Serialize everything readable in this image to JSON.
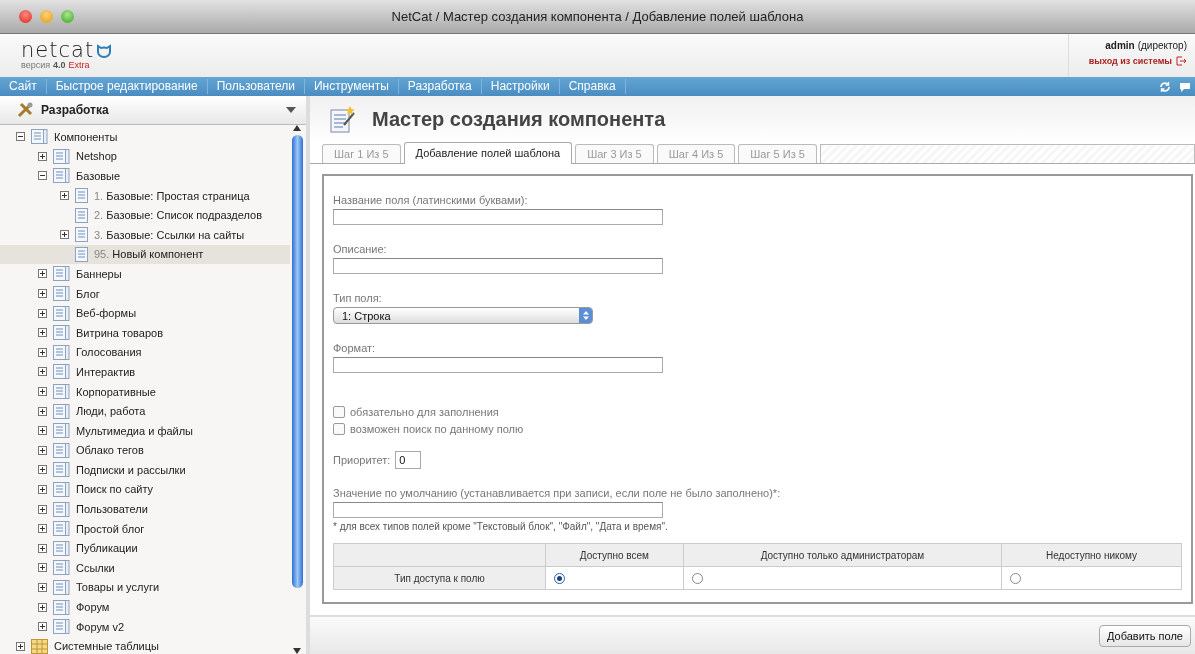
{
  "window": {
    "title": "NetCat / Мастер создания компонента / Добавление полей шаблона"
  },
  "header": {
    "logo": "netcat",
    "version_label": "версия",
    "version": "4.0",
    "edition": "Extra",
    "user": "admin",
    "role": "(директор)",
    "logout": "выход из системы"
  },
  "nav": [
    "Сайт",
    "Быстрое редактирование",
    "Пользователи",
    "Инструменты",
    "Разработка",
    "Настройки",
    "Справка"
  ],
  "sidebar": {
    "title": "Разработка",
    "tree": [
      {
        "label": "Компоненты",
        "kind": "group",
        "expanded": true,
        "selected": false,
        "children": [
          {
            "label": "Netshop",
            "kind": "group",
            "expanded": false,
            "selected": false
          },
          {
            "label": "Базовые",
            "kind": "group",
            "expanded": true,
            "selected": false,
            "children": [
              {
                "number": "1.",
                "label": "Базовые: Простая страница",
                "kind": "component",
                "expanded": false,
                "selected": false
              },
              {
                "number": "2.",
                "label": "Базовые: Список подразделов",
                "kind": "component",
                "selected": false
              },
              {
                "number": "3.",
                "label": "Базовые: Ссылки на сайты",
                "kind": "component",
                "expanded": false,
                "selected": false
              },
              {
                "number": "95.",
                "label": "Новый компонент",
                "kind": "component",
                "selected": true
              }
            ]
          },
          {
            "label": "Баннеры",
            "kind": "group",
            "expanded": false,
            "selected": false
          },
          {
            "label": "Блог",
            "kind": "group",
            "expanded": false,
            "selected": false
          },
          {
            "label": "Веб-формы",
            "kind": "group",
            "expanded": false,
            "selected": false
          },
          {
            "label": "Витрина товаров",
            "kind": "group",
            "expanded": false,
            "selected": false
          },
          {
            "label": "Голосования",
            "kind": "group",
            "expanded": false,
            "selected": false
          },
          {
            "label": "Интерактив",
            "kind": "group",
            "expanded": false,
            "selected": false
          },
          {
            "label": "Корпоративные",
            "kind": "group",
            "expanded": false,
            "selected": false
          },
          {
            "label": "Люди, работа",
            "kind": "group",
            "expanded": false,
            "selected": false
          },
          {
            "label": "Мультимедиа и файлы",
            "kind": "group",
            "expanded": false,
            "selected": false
          },
          {
            "label": "Облако тегов",
            "kind": "group",
            "expanded": false,
            "selected": false
          },
          {
            "label": "Подписки и рассылки",
            "kind": "group",
            "expanded": false,
            "selected": false
          },
          {
            "label": "Поиск по сайту",
            "kind": "group",
            "expanded": false,
            "selected": false
          },
          {
            "label": "Пользователи",
            "kind": "group",
            "expanded": false,
            "selected": false
          },
          {
            "label": "Простой блог",
            "kind": "group",
            "expanded": false,
            "selected": false
          },
          {
            "label": "Публикации",
            "kind": "group",
            "expanded": false,
            "selected": false
          },
          {
            "label": "Ссылки",
            "kind": "group",
            "expanded": false,
            "selected": false
          },
          {
            "label": "Товары и услуги",
            "kind": "group",
            "expanded": false,
            "selected": false
          },
          {
            "label": "Форум",
            "kind": "group",
            "expanded": false,
            "selected": false
          },
          {
            "label": "Форум v2",
            "kind": "group",
            "expanded": false,
            "selected": false
          }
        ]
      },
      {
        "label": "Системные таблицы",
        "kind": "system",
        "expanded": false,
        "selected": false
      }
    ]
  },
  "main": {
    "title": "Мастер создания компонента",
    "tabs": [
      {
        "label": "Шаг 1 Из 5",
        "selected": false
      },
      {
        "label": "Добавление полей шаблона",
        "selected": true
      },
      {
        "label": "Шаг 3 Из 5",
        "selected": false
      },
      {
        "label": "Шаг 4 Из 5",
        "selected": false
      },
      {
        "label": "Шаг 5 Из 5",
        "selected": false
      }
    ],
    "field_name": {
      "label": "Название поля (латинскими буквами):"
    },
    "description": {
      "label": "Описание:"
    },
    "field_type": {
      "label": "Тип поля:",
      "value": "1: Строка"
    },
    "format": {
      "label": "Формат:"
    },
    "checkboxes": [
      {
        "label": "обязательно для заполнения",
        "checked": false
      },
      {
        "label": "возможен поиск по данному полю",
        "checked": false
      }
    ],
    "priority": {
      "label": "Приоритет:",
      "value": "0"
    },
    "default_value": {
      "label": "Значение по умолчанию (устанавливается при записи, если поле не было заполнено)*:"
    },
    "footnote": "* для всех типов полей кроме \"Текстовый блок\", \"Файл\", \"Дата и время\".",
    "access": {
      "row_label": "Тип доступа к полю",
      "options": [
        {
          "label": "Доступно всем",
          "selected": true
        },
        {
          "label": "Доступно только администраторам",
          "selected": false
        },
        {
          "label": "Недоступно никому",
          "selected": false
        }
      ]
    },
    "add_button": "Добавить поле"
  }
}
